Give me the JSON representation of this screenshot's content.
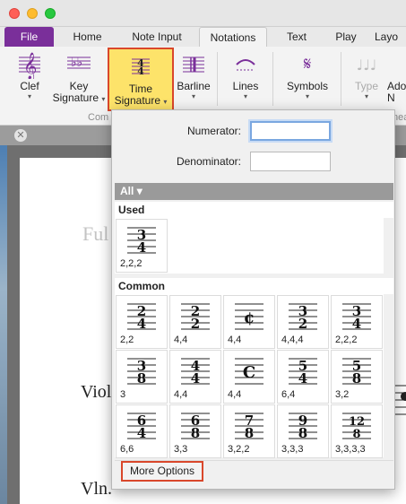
{
  "ribbon_tabs": [
    "File",
    "Home",
    "Note Input",
    "Notations",
    "Text",
    "Play",
    "Layo"
  ],
  "ribbon_buttons": {
    "clef": "Clef",
    "key_line1": "Key",
    "key_line2": "Signature",
    "time_line1": "Time",
    "time_line2": "Signature",
    "barline": "Barline",
    "lines": "Lines",
    "symbols": "Symbols",
    "type": "Type",
    "add_line1": "Ado",
    "add_line2": "N"
  },
  "ribbon_group_labels": {
    "common": "Com",
    "linear": "nea"
  },
  "document": {
    "ful": "Ful",
    "viol": "Viol",
    "vln": "Vln."
  },
  "popup": {
    "numerator_label": "Numerator:",
    "numerator_value": "",
    "denominator_label": "Denominator:",
    "denominator_value": "",
    "filter": "All",
    "used_header": "Used",
    "common_header": "Common",
    "used": [
      {
        "top": "3",
        "bottom": "4",
        "pattern": "2,2,2"
      }
    ],
    "common": [
      {
        "top": "2",
        "bottom": "4",
        "pattern": "2,2"
      },
      {
        "top": "2",
        "bottom": "2",
        "pattern": "4,4"
      },
      {
        "symbol": "¢",
        "pattern": "4,4"
      },
      {
        "top": "3",
        "bottom": "2",
        "pattern": "4,4,4"
      },
      {
        "top": "3",
        "bottom": "4",
        "pattern": "2,2,2"
      },
      {
        "top": "3",
        "bottom": "8",
        "pattern": "3"
      },
      {
        "top": "4",
        "bottom": "4",
        "pattern": "4,4"
      },
      {
        "symbol": "C",
        "pattern": "4,4"
      },
      {
        "top": "5",
        "bottom": "4",
        "pattern": "6,4"
      },
      {
        "top": "5",
        "bottom": "8",
        "pattern": "3,2"
      },
      {
        "top": "6",
        "bottom": "4",
        "pattern": "6,6"
      },
      {
        "top": "6",
        "bottom": "8",
        "pattern": "3,3"
      },
      {
        "top": "7",
        "bottom": "8",
        "pattern": "3,2,2"
      },
      {
        "top": "9",
        "bottom": "8",
        "pattern": "3,3,3"
      },
      {
        "top": "12",
        "bottom": "8",
        "pattern": "3,3,3,3"
      }
    ],
    "more_options": "More Options"
  }
}
